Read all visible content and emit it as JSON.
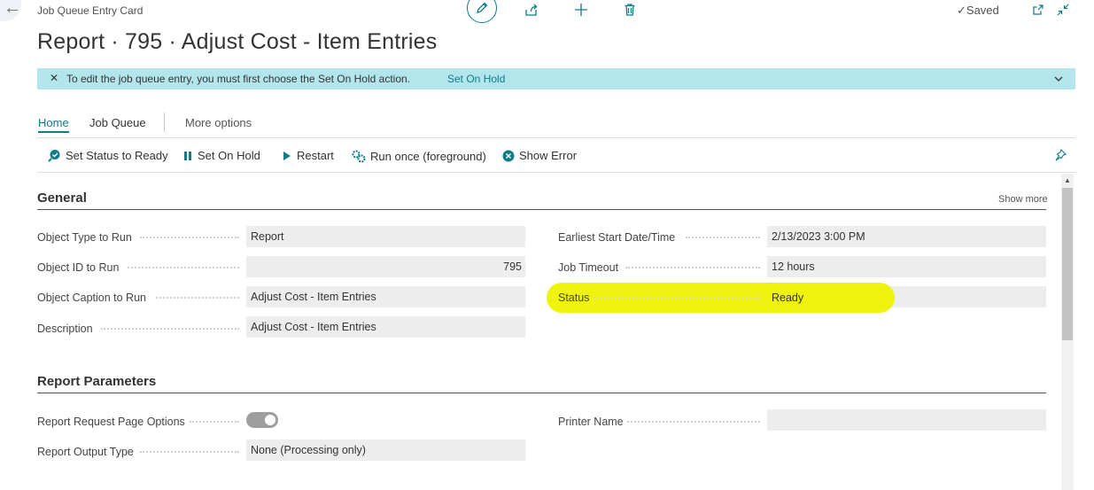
{
  "header": {
    "breadcrumb": "Job Queue Entry Card",
    "title": "Report · 795 · Adjust Cost - Item Entries",
    "saved_label": "Saved"
  },
  "banner": {
    "message": "To edit the job queue entry, you must first choose the Set On Hold action.",
    "link": "Set On Hold"
  },
  "tabs": [
    {
      "label": "Home",
      "active": true
    },
    {
      "label": "Job Queue"
    },
    {
      "label": "More options"
    }
  ],
  "actions": [
    {
      "label": "Set Status to Ready",
      "icon": "status-ready-icon"
    },
    {
      "label": "Set On Hold",
      "icon": "pause-icon"
    },
    {
      "label": "Restart",
      "icon": "play-icon"
    },
    {
      "label": "Run once (foreground)",
      "icon": "gears-icon"
    },
    {
      "label": "Show Error",
      "icon": "error-icon"
    }
  ],
  "general": {
    "title": "General",
    "show_more": "Show more",
    "left": [
      {
        "label": "Object Type to Run",
        "value": "Report"
      },
      {
        "label": "Object ID to Run",
        "value": "795"
      },
      {
        "label": "Object Caption to Run",
        "value": "Adjust Cost - Item Entries"
      },
      {
        "label": "Description",
        "value": "Adjust Cost - Item Entries"
      }
    ],
    "right": [
      {
        "label": "Earliest Start Date/Time",
        "value": "2/13/2023 3:00 PM"
      },
      {
        "label": "Job Timeout",
        "value": "12 hours"
      },
      {
        "label": "Status",
        "value": "Ready"
      }
    ]
  },
  "report_parameters": {
    "title": "Report Parameters",
    "request_page_label": "Report Request Page Options",
    "request_page_enabled": true,
    "output_type_label": "Report Output Type",
    "output_type_value": "None (Processing only)",
    "printer_label": "Printer Name",
    "printer_value": ""
  },
  "colors": {
    "accent": "#0f7c87",
    "banner": "#b3e6ec",
    "highlight": "#eef200"
  }
}
